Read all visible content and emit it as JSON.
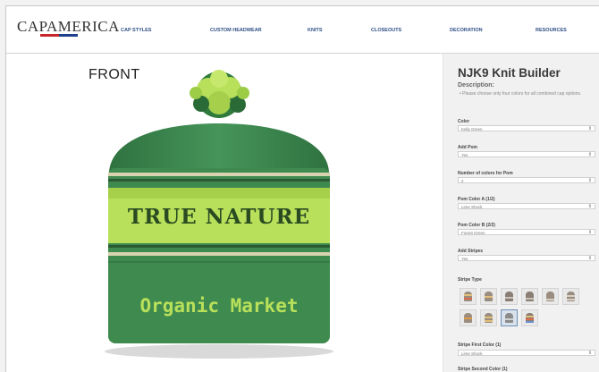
{
  "brand": {
    "logo_text": "CAPAMERICA",
    "accent_red": "#c8262b",
    "accent_blue": "#1e3f8a"
  },
  "nav": [
    {
      "label": "CAP STYLES"
    },
    {
      "label": "CUSTOM HEADWEAR"
    },
    {
      "label": "KNITS"
    },
    {
      "label": "CLOSEOUTS"
    },
    {
      "label": "DECORATION"
    },
    {
      "label": "RESOURCES"
    }
  ],
  "preview": {
    "view_label": "FRONT",
    "beanie": {
      "body_color": "#3f8a4f",
      "stripe_color": "#b8e05a",
      "accent_stripe_color": "#d8d3b0",
      "pom_colors": [
        "#b8e05a",
        "#2f7a3d"
      ],
      "band_text": "TRUE NATURE",
      "band_text_color": "#2a4a22",
      "bottom_text": "Organic Market",
      "bottom_text_color": "#b8e05a"
    }
  },
  "builder": {
    "title": "NJK9 Knit Builder",
    "description_label": "Description:",
    "description_text": "• Please choose only four colors for all combined cap options.",
    "fields": [
      {
        "label": "Color",
        "value": "Kelly Green"
      },
      {
        "label": "Add Pom",
        "value": "Yes"
      },
      {
        "label": "Number of colors for Pom",
        "value": "2"
      },
      {
        "label": "Pom Color A (1/2)",
        "value": "Lime Shock"
      },
      {
        "label": "Pom Color B (2/2)",
        "value": "Forest Green"
      },
      {
        "label": "Add Stripes",
        "value": "Yes"
      }
    ],
    "stripe_type_label": "Stripe Type",
    "stripe_types": [
      {
        "icon": "stripe-type-icon",
        "selected": false
      },
      {
        "icon": "stripe-type-icon",
        "selected": false
      },
      {
        "icon": "stripe-type-icon",
        "selected": false
      },
      {
        "icon": "stripe-type-icon",
        "selected": false
      },
      {
        "icon": "stripe-type-icon",
        "selected": false
      },
      {
        "icon": "stripe-type-icon",
        "selected": false
      },
      {
        "icon": "stripe-type-icon",
        "selected": false
      },
      {
        "icon": "stripe-type-icon",
        "selected": false
      },
      {
        "icon": "stripe-type-icon",
        "selected": true
      },
      {
        "icon": "stripe-type-icon",
        "selected": false
      }
    ],
    "stripe_first_color": {
      "label": "Stripe First Color (1)",
      "value": "Lime Shock"
    },
    "stripe_second_color": {
      "label": "Stripe Second Color (1)"
    }
  }
}
